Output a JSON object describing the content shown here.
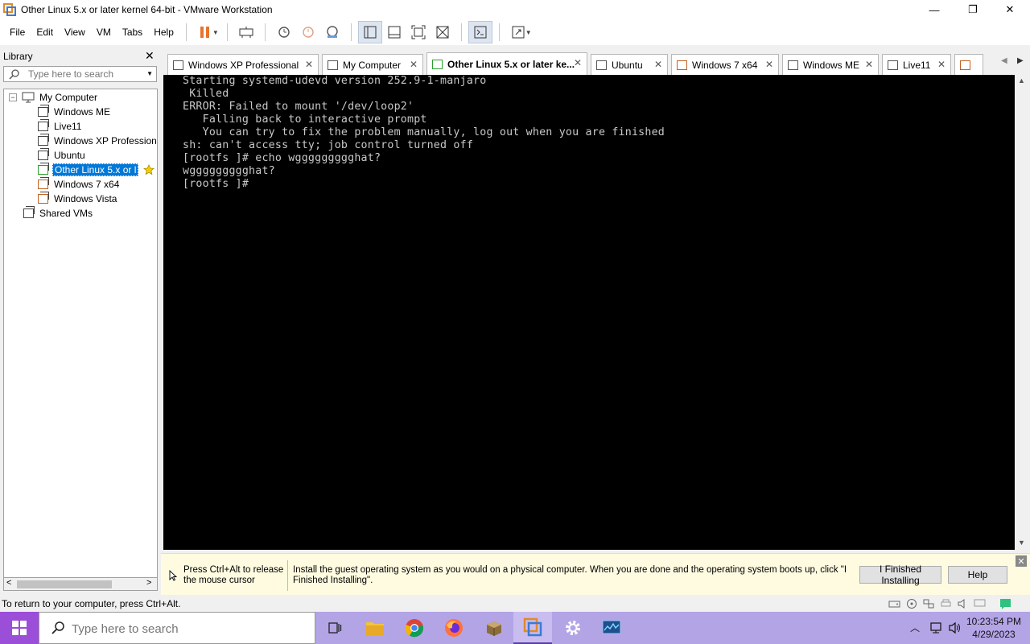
{
  "window": {
    "title": "Other Linux 5.x or later kernel 64-bit - VMware Workstation",
    "minimize": "—",
    "maximize": "❐",
    "close": "✕"
  },
  "menu": [
    "File",
    "Edit",
    "View",
    "VM",
    "Tabs",
    "Help"
  ],
  "library": {
    "header": "Library",
    "close": "✕",
    "search_placeholder": "Type here to search",
    "root": "My Computer",
    "items": [
      {
        "label": "Windows ME",
        "selected": false
      },
      {
        "label": "Live11",
        "selected": false
      },
      {
        "label": "Windows XP Professiona",
        "selected": false
      },
      {
        "label": "Ubuntu",
        "selected": false
      },
      {
        "label": "Other Linux 5.x or l",
        "selected": true
      },
      {
        "label": "Windows 7 x64",
        "selected": false
      },
      {
        "label": "Windows Vista",
        "selected": false
      }
    ],
    "shared": "Shared VMs",
    "tree_toggle": "−",
    "scroll_left": "<",
    "scroll_right": ">"
  },
  "tabs": [
    {
      "label": "Windows XP Professional",
      "active": false
    },
    {
      "label": "My Computer",
      "active": false
    },
    {
      "label": "Other Linux 5.x or later ke...",
      "active": true
    },
    {
      "label": "Ubuntu",
      "active": false
    },
    {
      "label": "Windows 7 x64",
      "active": false
    },
    {
      "label": "Windows ME",
      "active": false
    },
    {
      "label": "Live11",
      "active": false
    }
  ],
  "tab_close": "✕",
  "tab_scroll_left": "◀",
  "tab_scroll_right": "▶",
  "console": {
    "lines": [
      "Starting systemd-udevd version 252.9-1-manjaro",
      " Killed",
      "ERROR: Failed to mount '/dev/loop2'",
      "   Falling back to interactive prompt",
      "   You can try to fix the problem manually, log out when you are finished",
      "sh: can't access tty; job control turned off",
      "[rootfs ]# echo wggggggggghat?",
      "wggggggggghat?",
      "[rootfs ]#"
    ]
  },
  "hint": {
    "release": "Press Ctrl+Alt to release the mouse cursor",
    "message": "Install the guest operating system as you would on a physical computer. When you are done and the operating system boots up, click \"I Finished Installing\".",
    "finished_button": "I Finished Installing",
    "help_button": "Help",
    "close": "✕"
  },
  "status": {
    "text": "To return to your computer, press Ctrl+Alt."
  },
  "taskbar": {
    "search_placeholder": "Type here to search",
    "time": "10:23:54 PM",
    "date": "4/29/2023"
  },
  "colors": {
    "taskbar": "#b3a4e6",
    "start": "#9b4fd8",
    "selection": "#0078d7",
    "console_bg": "#000000",
    "pause": "#e8742c"
  }
}
